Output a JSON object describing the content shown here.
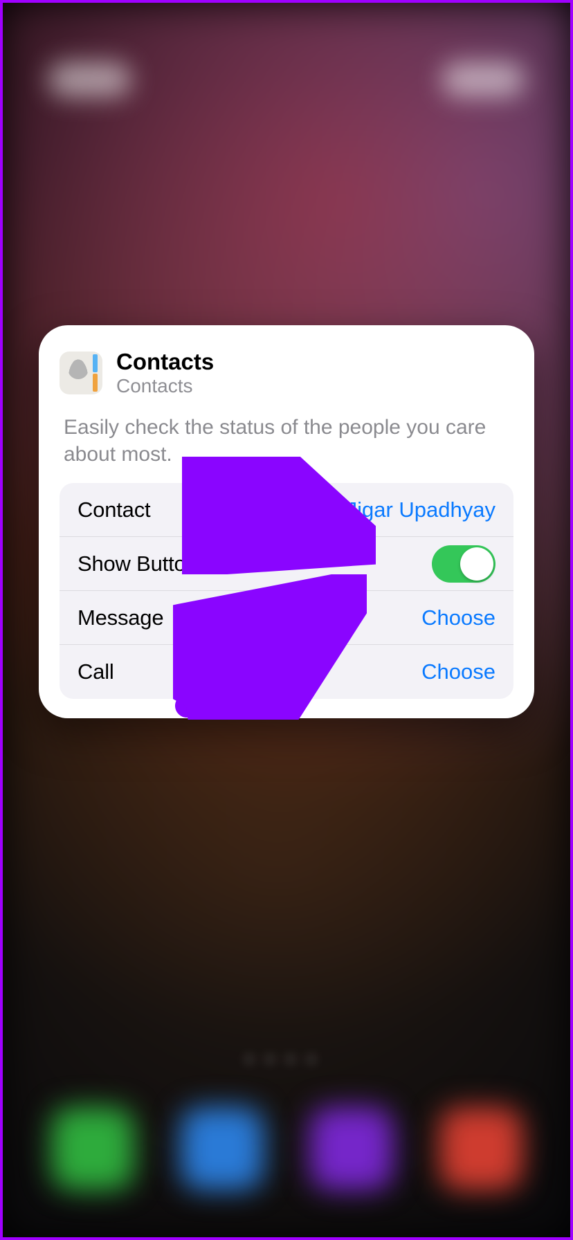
{
  "widget": {
    "title": "Contacts",
    "subtitle": "Contacts",
    "description": "Easily check the status of the people you care about most."
  },
  "rows": {
    "contact": {
      "label": "Contact",
      "value": "Jigar Upadhyay"
    },
    "show_buttons": {
      "label": "Show Buttons",
      "on": true
    },
    "message": {
      "label": "Message",
      "value": "Choose"
    },
    "call": {
      "label": "Call",
      "value": "Choose"
    }
  }
}
